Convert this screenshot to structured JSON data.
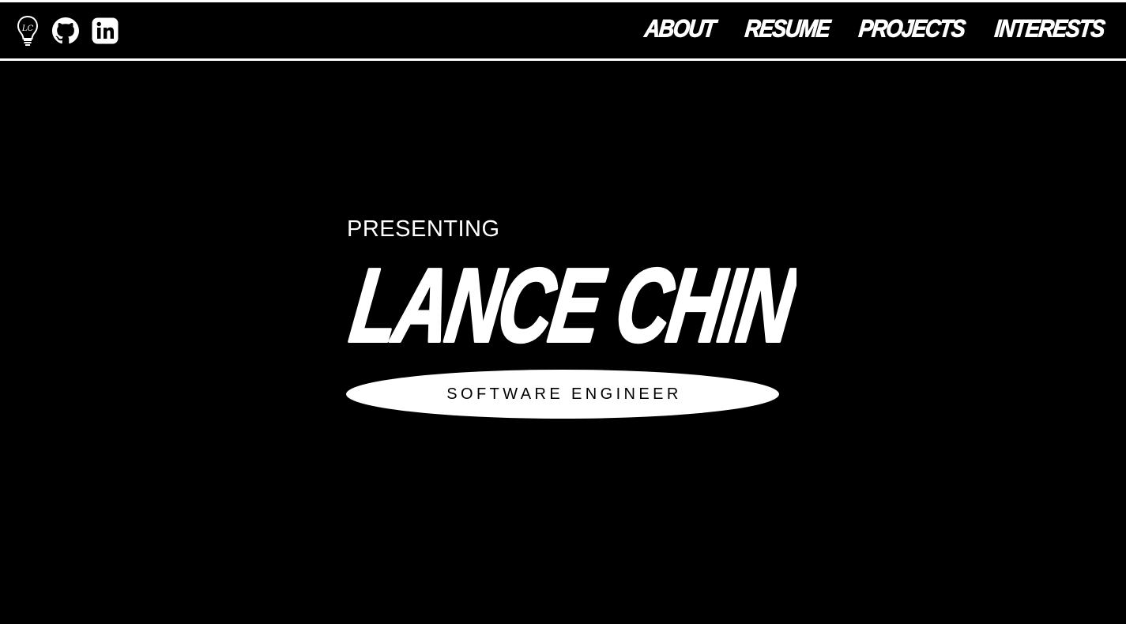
{
  "nav": {
    "icons": {
      "logo": "lightbulb-logo-icon",
      "github": "github-icon",
      "linkedin": "linkedin-icon"
    },
    "logo_initials": "LC",
    "links": [
      {
        "label": "ABOUT"
      },
      {
        "label": "RESUME"
      },
      {
        "label": "PROJECTS"
      },
      {
        "label": "INTERESTS"
      }
    ]
  },
  "hero": {
    "eyebrow": "PRESENTING",
    "name": "LANCE CHIN",
    "role": "SOFTWARE ENGINEER"
  },
  "colors": {
    "background": "#000000",
    "foreground": "#ffffff"
  }
}
